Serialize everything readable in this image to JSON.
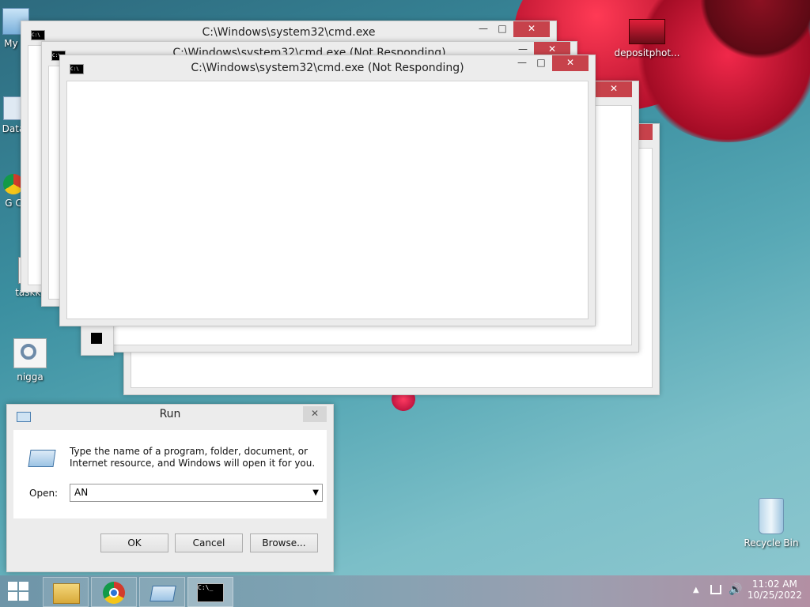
{
  "desktop": {
    "icons": [
      {
        "label": "My C"
      },
      {
        "label": "Data"
      },
      {
        "label": "G C"
      },
      {
        "label": "taskki"
      },
      {
        "label": "nigga"
      },
      {
        "label": "depositphot..."
      },
      {
        "label": "Recycle Bin"
      }
    ]
  },
  "windows": {
    "cmd1_title": "C:\\Windows\\system32\\cmd.exe",
    "cmd2_title": "C:\\Windows\\system32\\cmd.exe (Not Responding)",
    "cmd3_title": "C:\\Windows\\system32\\cmd.exe (Not Responding)",
    "minimize": "—",
    "maximize": "□",
    "close": "✕"
  },
  "run": {
    "title": "Run",
    "description": "Type the name of a program, folder, document, or Internet resource, and Windows will open it for you.",
    "open_label": "Open:",
    "open_value": "AN",
    "ok": "OK",
    "cancel": "Cancel",
    "browse": "Browse...",
    "close": "✕"
  },
  "taskbar": {
    "items": [
      "start",
      "file-explorer",
      "chrome",
      "run",
      "cmd"
    ]
  },
  "tray": {
    "time": "11:02 AM",
    "date": "10/25/2022"
  },
  "colors": {
    "close_red": "#c7424b",
    "desktop_teal": "#3b8fa0",
    "flower_red": "#d41f3a"
  }
}
